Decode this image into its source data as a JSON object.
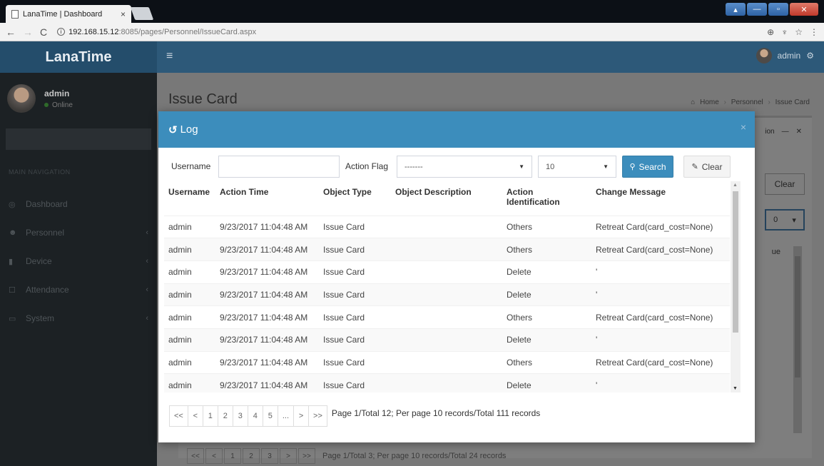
{
  "browser": {
    "tab_title": "LanaTime | Dashboard",
    "tab_close": "×",
    "url_host": "192.168.15.12",
    "url_path": ":8085/pages/Personnel/IssueCard.aspx",
    "addr_icons": [
      "zoom-icon",
      "extension-icon",
      "star-icon",
      "menu-icon"
    ]
  },
  "header": {
    "logo": "LanaTime",
    "menu_glyph": "≡",
    "username": "admin"
  },
  "sidebar": {
    "user_name": "admin",
    "user_status": "Online",
    "section_header": "MAIN NAVIGATION",
    "items": [
      {
        "label": "Dashboard",
        "icon": "◎",
        "chevron": ""
      },
      {
        "label": "Personnel",
        "icon": "☻",
        "chevron": "‹"
      },
      {
        "label": "Device",
        "icon": "▮",
        "chevron": "‹"
      },
      {
        "label": "Attendance",
        "icon": "☐",
        "chevron": "‹"
      },
      {
        "label": "System",
        "icon": "▭",
        "chevron": "‹"
      }
    ]
  },
  "page": {
    "title": "Issue Card",
    "breadcrumb": [
      "Home",
      "Personnel",
      "Issue Card"
    ],
    "bg_tools": [
      "ion",
      "—",
      "✕"
    ],
    "bg_clear": "Clear",
    "bg_select": "0",
    "bg_col": "ue",
    "bg_pager": [
      "<<",
      "<",
      "1",
      "2",
      "3",
      ">",
      ">>"
    ],
    "bg_pager_info": "Page 1/Total 3; Per page 10 records/Total 24 records"
  },
  "modal": {
    "title_icon": "↺",
    "title": "Log",
    "close": "×",
    "filters": {
      "username_label": "Username",
      "username_value": "",
      "action_flag_label": "Action Flag",
      "action_flag_value": "-------",
      "page_size_value": "10",
      "search_label": "Search",
      "clear_label": "Clear"
    },
    "columns": [
      "Username",
      "Action Time",
      "Object Type",
      "Object Description",
      "Action Identification",
      "Change Message"
    ],
    "rows": [
      [
        "admin",
        "9/23/2017 11:04:48 AM",
        "Issue Card",
        "",
        "Others",
        "Retreat Card(card_cost=None)"
      ],
      [
        "admin",
        "9/23/2017 11:04:48 AM",
        "Issue Card",
        "",
        "Others",
        "Retreat Card(card_cost=None)"
      ],
      [
        "admin",
        "9/23/2017 11:04:48 AM",
        "Issue Card",
        "",
        "Delete",
        "'"
      ],
      [
        "admin",
        "9/23/2017 11:04:48 AM",
        "Issue Card",
        "",
        "Delete",
        "'"
      ],
      [
        "admin",
        "9/23/2017 11:04:48 AM",
        "Issue Card",
        "",
        "Others",
        "Retreat Card(card_cost=None)"
      ],
      [
        "admin",
        "9/23/2017 11:04:48 AM",
        "Issue Card",
        "",
        "Delete",
        "'"
      ],
      [
        "admin",
        "9/23/2017 11:04:48 AM",
        "Issue Card",
        "",
        "Others",
        "Retreat Card(card_cost=None)"
      ],
      [
        "admin",
        "9/23/2017 11:04:48 AM",
        "Issue Card",
        "",
        "Delete",
        "'"
      ]
    ],
    "pager": [
      "<<",
      "<",
      "1",
      "2",
      "3",
      "4",
      "5",
      "...",
      ">",
      ">>"
    ],
    "pager_info": "Page 1/Total 12; Per page 10 records/Total 111 records"
  },
  "colors": {
    "accent": "#3c8dbc",
    "header": "#2d5979",
    "sidebar": "#1c2124"
  }
}
